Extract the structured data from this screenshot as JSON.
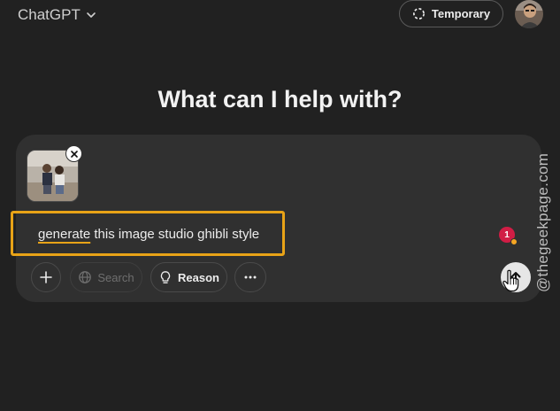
{
  "header": {
    "model_name": "ChatGPT",
    "temporary_label": "Temporary"
  },
  "main": {
    "headline": "What can I help with?"
  },
  "composer": {
    "prompt_word_1": "generate",
    "prompt_rest": " this image studio ghibli style",
    "search_label": "Search",
    "reason_label": "Reason",
    "notification_count": "1"
  },
  "watermark": "@thegeekpage.com",
  "colors": {
    "background": "#212121",
    "composer": "#303030",
    "highlight": "#e8a317",
    "badge": "#d11d45"
  },
  "icons": {
    "model": "chevron-down-icon",
    "temporary": "dashed-circle-icon",
    "attach": "plus-icon",
    "search": "globe-icon",
    "reason": "lightbulb-icon",
    "more": "ellipsis-icon",
    "send": "arrow-up-icon",
    "remove": "close-icon"
  }
}
